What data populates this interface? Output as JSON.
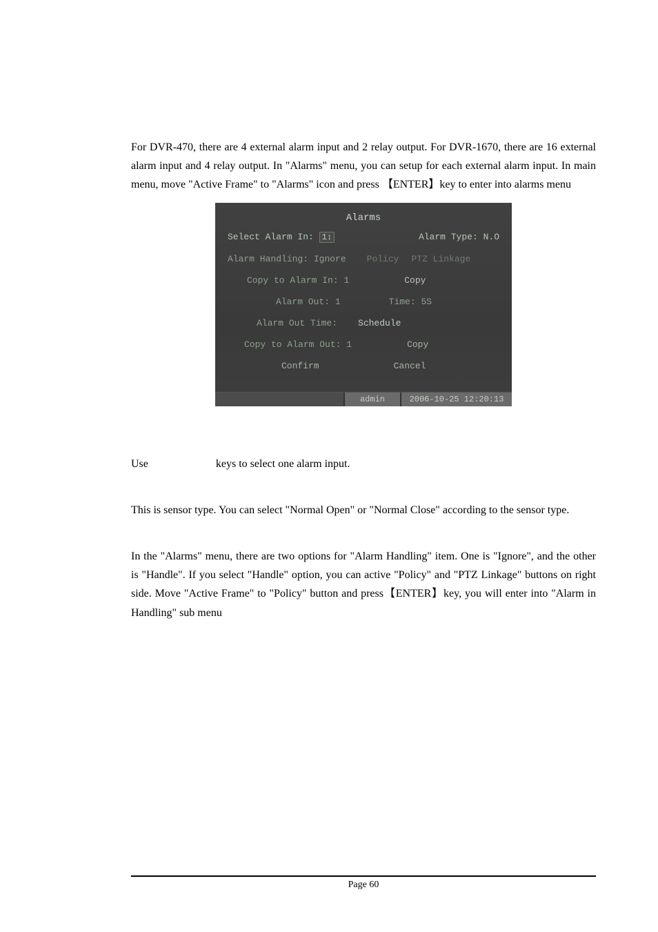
{
  "paragraphs": {
    "intro": "For DVR-470, there are 4 external alarm input and 2 relay output. For DVR-1670, there are 16 external alarm input and 4 relay output. In \"Alarms\" menu, you can setup for each external alarm input. In main menu, move \"Active Frame\" to \"Alarms\" icon and press 【ENTER】key to enter into alarms menu",
    "selectInstr_a": "Use",
    "selectInstr_b": "keys to select one alarm input.",
    "sensor": "This is sensor type. You can select \"Normal Open\" or \"Normal Close\" according to the sensor type.",
    "handling": "In the \"Alarms\" menu, there are two options for \"Alarm Handling\" item. One is \"Ignore\", and the other is \"Handle\". If you select \"Handle\" option, you can active \"Policy\" and \"PTZ Linkage\" buttons on right side. Move \"Active Frame\" to \"Policy\" button and press【ENTER】key, you will enter into \"Alarm in Handling\" sub menu"
  },
  "alarms": {
    "title": "Alarms",
    "selectAlarmInLabel": "Select Alarm In:",
    "selectAlarmInValue": "1↕",
    "alarmTypeLabel": "Alarm Type:",
    "alarmTypeValue": "N.O",
    "alarmHandlingLabel": "Alarm Handling:",
    "alarmHandlingValue": "Ignore",
    "policy": "Policy",
    "ptzLinkage": "PTZ Linkage",
    "copyToAlarmInLabel": "Copy to Alarm In:",
    "copyToAlarmInValue": "1",
    "copyBtn": "Copy",
    "alarmOutLabel": "Alarm Out:",
    "alarmOutValue": "1",
    "timeLabel": "Time:",
    "timeValue": "5S",
    "alarmOutTimeLabel": "Alarm Out Time:",
    "scheduleBtn": "Schedule",
    "copyToAlarmOutLabel": "Copy to Alarm Out:",
    "copyToAlarmOutValue": "1",
    "copyBtn2": "Copy",
    "confirm": "Confirm",
    "cancel": "Cancel",
    "statusUser": "admin",
    "statusTime": "2006-10-25 12:20:13"
  },
  "footer": "Page 60"
}
